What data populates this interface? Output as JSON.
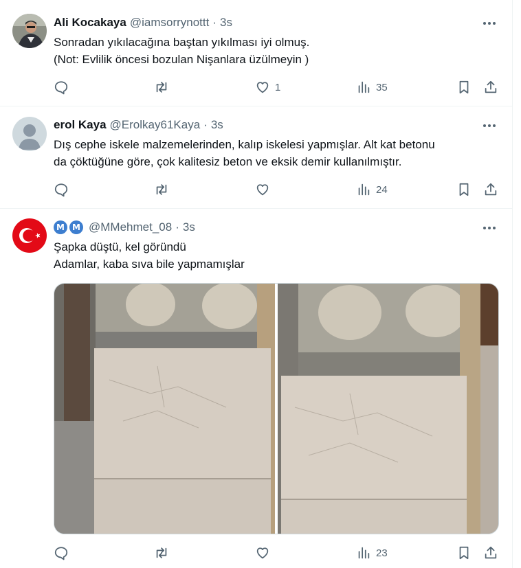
{
  "tweets": [
    {
      "name": "Ali Kocakaya",
      "handle": "@iamsorrynottt",
      "separator": "·",
      "time": "3s",
      "lines": [
        "Sonradan yıkılacağına baştan yıkılması iyi olmuş.",
        "(Not: Evlilik öncesi bozulan Nişanlara üzülmeyin )"
      ],
      "likes": "1",
      "views": "35",
      "avatar_icon": "person-photo-avatar"
    },
    {
      "name": "erol Kaya",
      "handle": "@Erolkay61Kaya",
      "separator": "·",
      "time": "3s",
      "lines": [
        "Dış cephe iskele malzemelerinden, kalıp iskelesi yapmışlar. Alt kat betonu",
        "da çöktüğüne göre, çok kalitesiz beton ve eksik demir kullanılmıştır."
      ],
      "likes": "",
      "views": "24",
      "avatar_icon": "default-user-avatar"
    },
    {
      "name_badges": [
        "M",
        "M"
      ],
      "handle": "@MMehmet_08",
      "separator": "·",
      "time": "3s",
      "lines": [
        "Şapka düştü, kel göründü",
        "Adamlar, kaba sıva bile yapmamışlar"
      ],
      "likes": "",
      "views": "23",
      "avatar_icon": "turkish-flag-avatar"
    }
  ],
  "colors": {
    "text": "#0f1419",
    "secondary": "#536471",
    "border": "#eff3f4",
    "badge_blue": "#3d7ecf",
    "flag_red": "#e30a17"
  },
  "icons": [
    "reply-icon",
    "retweet-icon",
    "like-icon",
    "views-icon",
    "bookmark-icon",
    "share-icon",
    "more-icon"
  ]
}
